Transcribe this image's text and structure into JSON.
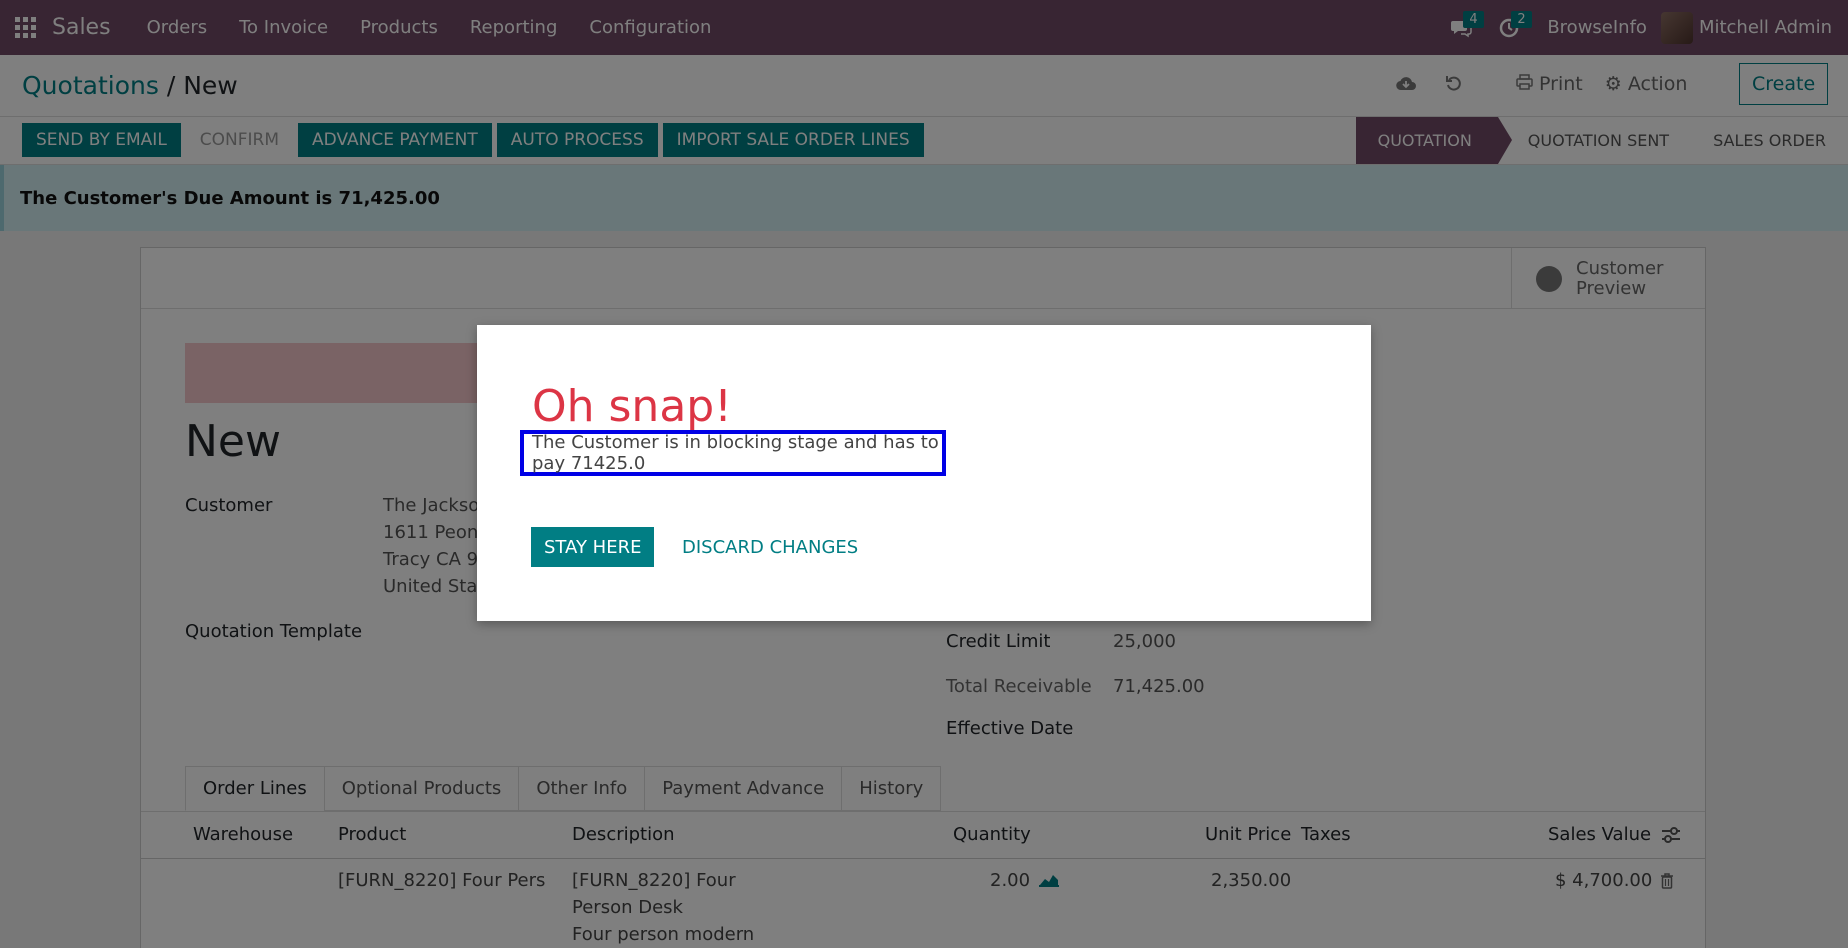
{
  "navbar": {
    "app_name": "Sales",
    "menu": [
      "Orders",
      "To Invoice",
      "Products",
      "Reporting",
      "Configuration"
    ],
    "messages_count": "4",
    "activities_count": "2",
    "browseinfo": "BrowseInfo",
    "user_name": "Mitchell Admin"
  },
  "control_panel": {
    "breadcrumb_parent": "Quotations",
    "breadcrumb_sep": "/",
    "breadcrumb_current": "New",
    "print_label": "Print",
    "action_label": "Action",
    "create_label": "Create"
  },
  "statusbar": {
    "buttons": [
      "SEND BY EMAIL",
      "CONFIRM",
      "ADVANCE PAYMENT",
      "AUTO PROCESS",
      "IMPORT SALE ORDER LINES"
    ],
    "stages": [
      "QUOTATION",
      "QUOTATION SENT",
      "SALES ORDER"
    ]
  },
  "due_banner": "The Customer's Due Amount is 71,425.00",
  "form": {
    "customer_preview": [
      "Customer",
      "Preview"
    ],
    "title": "New",
    "customer_label": "Customer",
    "customer_address": [
      "The Jackso",
      "1611 Peon",
      "Tracy CA 9",
      "United Sta"
    ],
    "quotation_template_label": "Quotation Template",
    "credit_limit_label": "Credit Limit",
    "credit_limit_value": "25,000",
    "total_receivable_label": "Total Receivable",
    "total_receivable_value": "71,425.00",
    "effective_date_label": "Effective Date",
    "tabs": [
      "Order Lines",
      "Optional Products",
      "Other Info",
      "Payment Advance",
      "History"
    ],
    "columns": [
      "Warehouse",
      "Product",
      "Description",
      "Quantity",
      "Unit Price",
      "Taxes",
      "Sales Value"
    ],
    "row": {
      "product": "[FURN_8220] Four Pers",
      "description": [
        "[FURN_8220] Four",
        "Person Desk",
        "Four person modern"
      ],
      "quantity": "2.00",
      "unit_price": "2,350.00",
      "sales_value": "$ 4,700.00"
    }
  },
  "dialog": {
    "title": "Oh snap!",
    "message": "The Customer is in blocking stage and has to pay 71425.0",
    "stay_label": "STAY HERE",
    "discard_label": "DISCARD CHANGES"
  },
  "colors": {
    "brand": "#714b67",
    "primary": "#017e84",
    "danger": "#dc3545",
    "highlight_border": "#0000e6"
  }
}
